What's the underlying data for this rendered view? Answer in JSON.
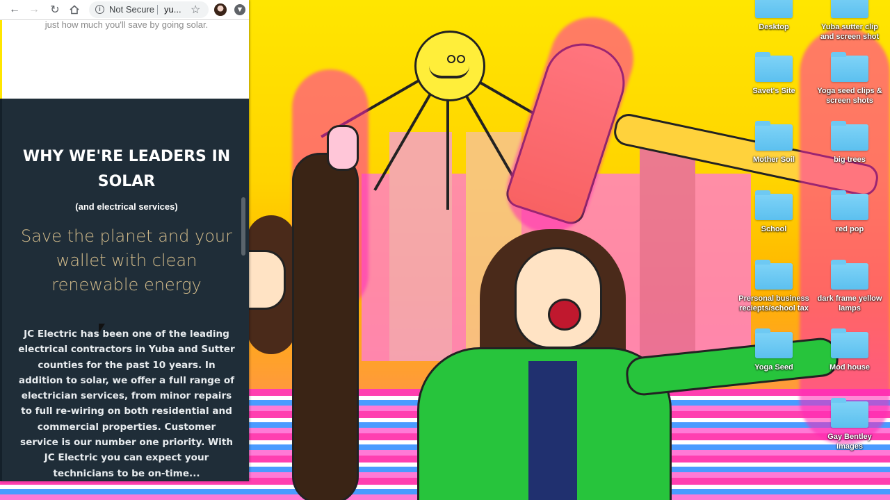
{
  "browser": {
    "security_label": "Not Secure",
    "url": "yu...",
    "nav": {
      "back": "back",
      "forward": "forward",
      "reload": "reload",
      "home": "home"
    }
  },
  "page": {
    "intro_tail": "just how much you'll save by going solar.",
    "headline": "WHY WE'RE LEADERS IN SOLAR",
    "subhead": "(and electrical services)",
    "tagline": "Save the planet and your wallet with clean renewable energy",
    "body": "JC Electric has been one of the leading electrical contractors in Yuba and Sutter counties for the past 10 years. In addition to solar, we offer a full range of electrician services, from minor repairs to full re-wiring on both residential and commercial properties. Customer service is our number one priority. With JC Electric you can expect your technicians to be on-time..."
  },
  "desktop": {
    "icons": [
      {
        "label": "Desktop"
      },
      {
        "label": "Yuba sutter clip and screen shot"
      },
      {
        "label": "Savet's Site"
      },
      {
        "label": "Yoga seed clips & screen shots"
      },
      {
        "label": "Mother Soil"
      },
      {
        "label": "big trees"
      },
      {
        "label": "School"
      },
      {
        "label": "red pop"
      },
      {
        "label": "Prersonal business reciepts/school tax"
      },
      {
        "label": "dark frame yellow lamps"
      },
      {
        "label": "Yoga Seed"
      },
      {
        "label": "Mod house"
      },
      {
        "label": "Gay Bentley Images"
      }
    ]
  },
  "colors": {
    "dark_section": "#1f2d38",
    "tagline": "#d4bd8c",
    "folder": "#6ec9f3"
  }
}
